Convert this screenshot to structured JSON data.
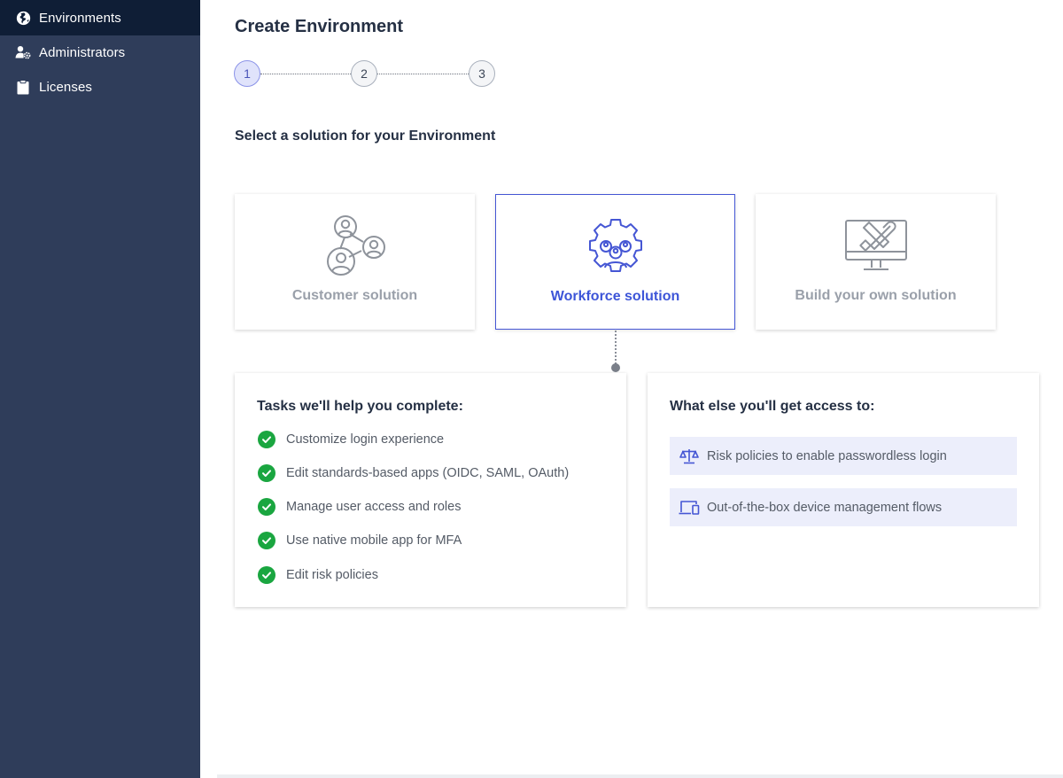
{
  "sidebar": {
    "items": [
      {
        "label": "Environments",
        "icon": "globe-icon",
        "active": true
      },
      {
        "label": "Administrators",
        "icon": "user-gear-icon",
        "active": false
      },
      {
        "label": "Licenses",
        "icon": "clipboard-icon",
        "active": false
      }
    ]
  },
  "page": {
    "title": "Create Environment",
    "steps": [
      "1",
      "2",
      "3"
    ],
    "current_step": 1,
    "section_heading": "Select a solution for your Environment"
  },
  "solutions": [
    {
      "label": "Customer solution",
      "icon": "people-network-icon",
      "selected": false
    },
    {
      "label": "Workforce solution",
      "icon": "gear-people-icon",
      "selected": true
    },
    {
      "label": "Build your own solution",
      "icon": "monitor-tools-icon",
      "selected": false
    }
  ],
  "tasks_panel": {
    "title": "Tasks we'll help you complete:",
    "items": [
      "Customize login experience",
      "Edit standards-based apps (OIDC, SAML, OAuth)",
      "Manage user access and roles",
      "Use native mobile app for MFA",
      "Edit risk policies"
    ]
  },
  "access_panel": {
    "title": "What else you'll get access to:",
    "items": [
      {
        "label": "Risk policies to enable passwordless login",
        "icon": "scale-icon"
      },
      {
        "label": "Out-of-the-box device management flows",
        "icon": "devices-icon"
      }
    ]
  },
  "colors": {
    "sidebar_bg": "#2f3d5a",
    "sidebar_active_bg": "#0f1e36",
    "accent": "#3d55d8",
    "success": "#1aa640",
    "perk_bg": "#eceefb"
  }
}
